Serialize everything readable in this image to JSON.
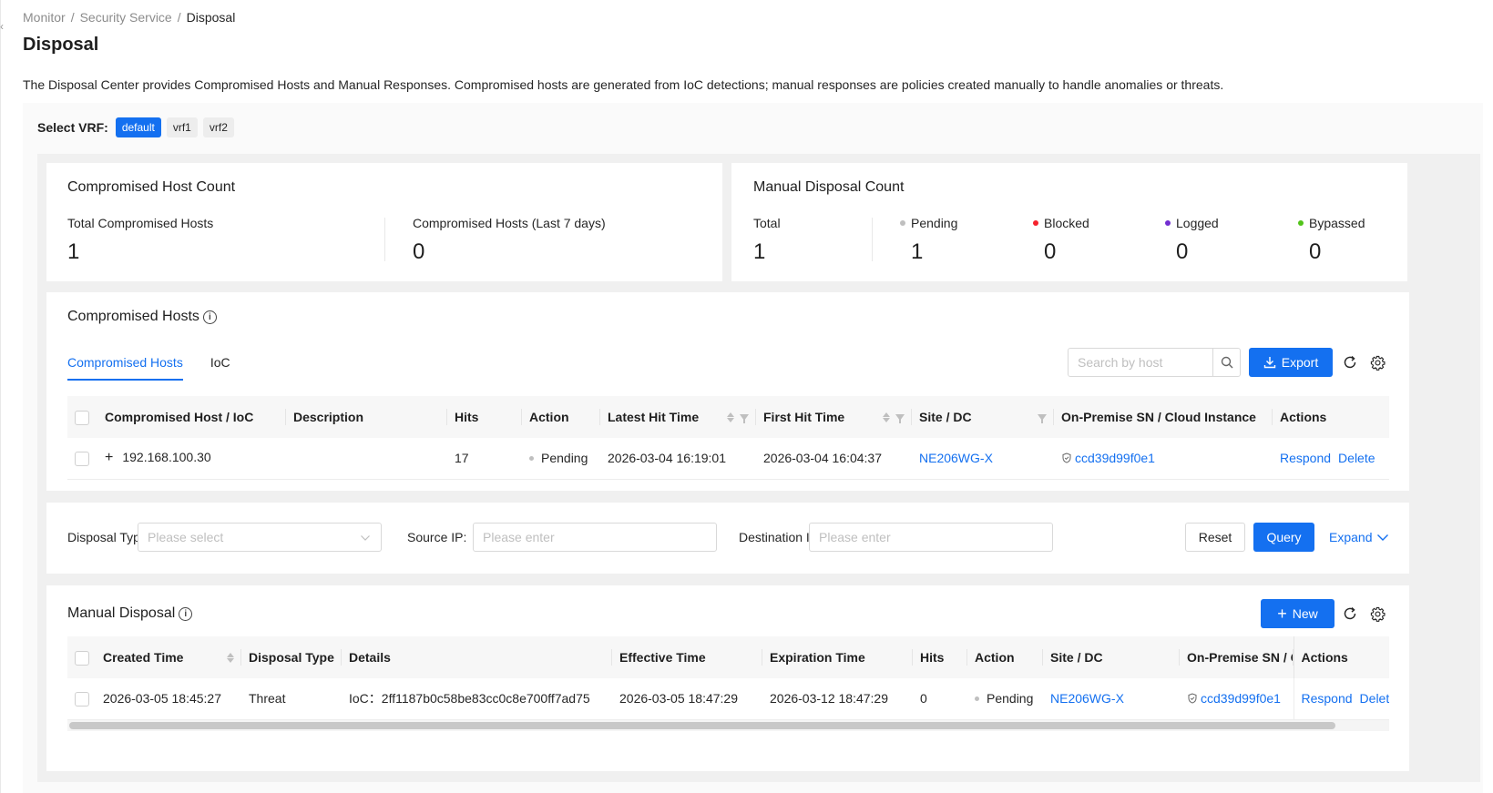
{
  "breadcrumb": [
    "Monitor",
    "Security Service",
    "Disposal"
  ],
  "breadcrumb_sep": "/",
  "page": {
    "title": "Disposal",
    "description": "The Disposal Center provides Compromised Hosts and Manual Responses. Compromised hosts are generated from IoC detections; manual responses are policies created manually to handle anomalies or threats."
  },
  "vrf": {
    "label": "Select VRF:",
    "options": [
      "default",
      "vrf1",
      "vrf2"
    ],
    "selected": "default"
  },
  "compromised_count": {
    "title": "Compromised Host Count",
    "total_label": "Total Compromised Hosts",
    "total_value": "1",
    "last7_label": "Compromised Hosts (Last 7 days)",
    "last7_value": "0"
  },
  "manual_count": {
    "title": "Manual Disposal Count",
    "total_label": "Total",
    "total_value": "1",
    "stats": [
      {
        "label": "Pending",
        "value": "1",
        "color": "#bfbfbf"
      },
      {
        "label": "Blocked",
        "value": "0",
        "color": "#f5222d"
      },
      {
        "label": "Logged",
        "value": "0",
        "color": "#722ed1"
      },
      {
        "label": "Bypassed",
        "value": "0",
        "color": "#52c41a"
      }
    ]
  },
  "compromised_hosts": {
    "title": "Compromised Hosts",
    "tabs": [
      "Compromised Hosts",
      "IoC"
    ],
    "active_tab": "Compromised Hosts",
    "search_placeholder": "Search by host",
    "export_label": "Export",
    "columns": [
      "Compromised Host / IoC",
      "Description",
      "Hits",
      "Action",
      "Latest Hit Time",
      "First Hit Time",
      "Site / DC",
      "On-Premise SN / Cloud Instance",
      "Actions"
    ],
    "rows": [
      {
        "host": "192.168.100.30",
        "description": "",
        "hits": "17",
        "action": "Pending",
        "latest_hit": "2026-03-04 16:19:01",
        "first_hit": "2026-03-04 16:04:37",
        "site": "NE206WG-X",
        "sn": "ccd39d99f0e1",
        "respond": "Respond",
        "delete": "Delete"
      }
    ]
  },
  "filter_form": {
    "disposal_type_label": "Disposal Type:",
    "disposal_type_placeholder": "Please select",
    "source_ip_label": "Source IP:",
    "source_ip_placeholder": "Please enter",
    "dest_ip_label": "Destination IP:",
    "dest_ip_placeholder": "Please enter",
    "reset_label": "Reset",
    "query_label": "Query",
    "expand_label": "Expand"
  },
  "manual_disposal": {
    "title": "Manual Disposal",
    "new_label": "New",
    "columns": [
      "Created Time",
      "Disposal Type",
      "Details",
      "Effective Time",
      "Expiration Time",
      "Hits",
      "Action",
      "Site / DC",
      "On-Premise SN / Cloud Instance",
      "Actions"
    ],
    "rows": [
      {
        "created": "2026-03-05 18:45:27",
        "type": "Threat",
        "details": "IoC：2ff1187b0c58be83cc0c8e700ff7ad75",
        "effective": "2026-03-05 18:47:29",
        "expiration": "2026-03-12 18:47:29",
        "hits": "0",
        "action": "Pending",
        "site": "NE206WG-X",
        "sn": "ccd39d99f0e1",
        "respond": "Respond",
        "delete": "Delete"
      }
    ]
  }
}
